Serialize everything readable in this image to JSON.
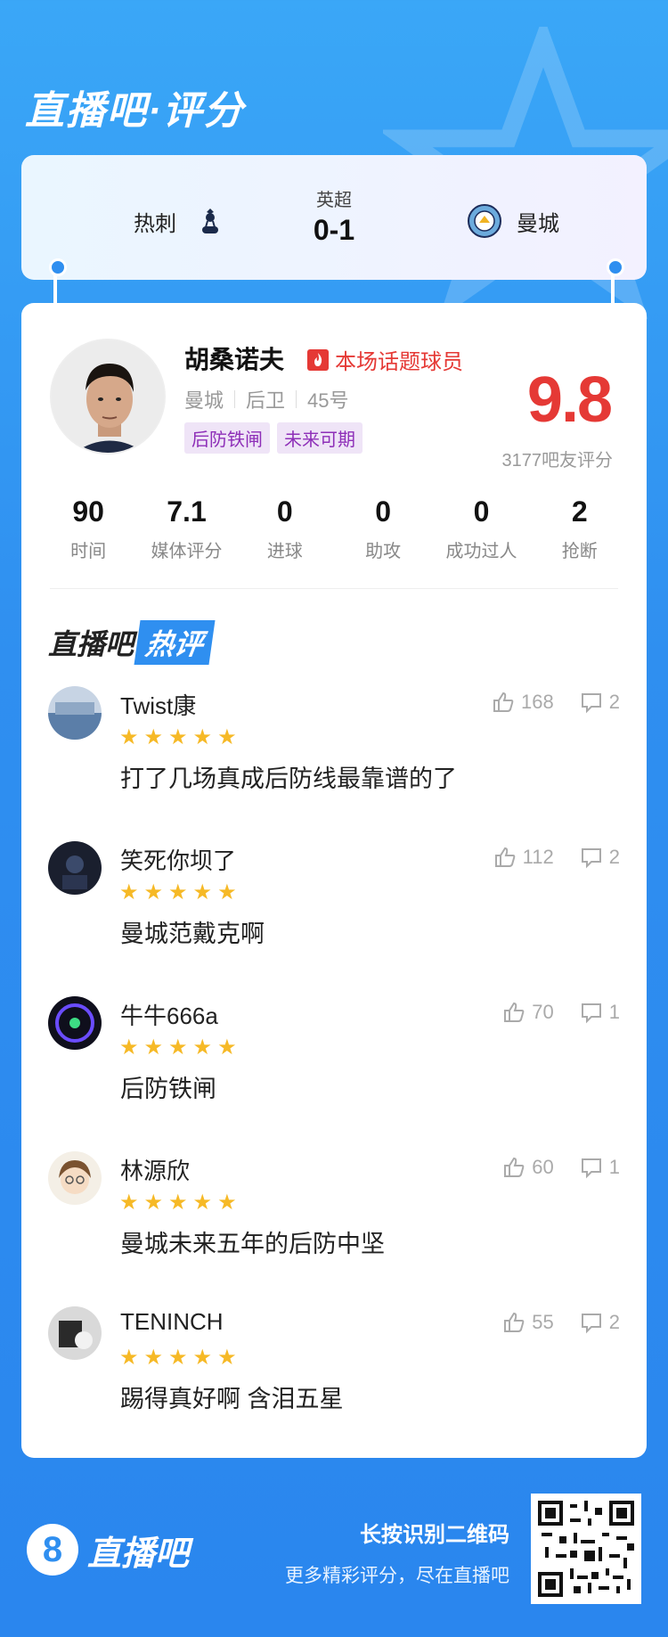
{
  "header": {
    "title": "直播吧·评分"
  },
  "match": {
    "league": "英超",
    "score": "0-1",
    "home_team": "热刺",
    "away_team": "曼城",
    "home_crest": "tottenham-crest-icon",
    "away_crest": "man-city-crest-icon"
  },
  "player": {
    "name": "胡桑诺夫",
    "badge": "本场话题球员",
    "team": "曼城",
    "position": "后卫",
    "number": "45号",
    "tags": [
      "后防铁闸",
      "未来可期"
    ],
    "rating": "9.8",
    "votes": "3177吧友评分"
  },
  "stats": [
    {
      "value": "90",
      "label": "时间"
    },
    {
      "value": "7.1",
      "label": "媒体评分"
    },
    {
      "value": "0",
      "label": "进球"
    },
    {
      "value": "0",
      "label": "助攻"
    },
    {
      "value": "0",
      "label": "成功过人"
    },
    {
      "value": "2",
      "label": "抢断"
    }
  ],
  "hot_section": {
    "title_a": "直播吧",
    "title_b": "热评"
  },
  "comments": [
    {
      "user": "Twist康",
      "likes": "168",
      "replies": "2",
      "stars": 5,
      "text": "打了几场真成后防线最靠谱的了"
    },
    {
      "user": "笑死你坝了",
      "likes": "112",
      "replies": "2",
      "stars": 5,
      "text": "曼城范戴克啊"
    },
    {
      "user": "牛牛666a",
      "likes": "70",
      "replies": "1",
      "stars": 5,
      "text": "后防铁闸"
    },
    {
      "user": "林源欣",
      "likes": "60",
      "replies": "1",
      "stars": 5,
      "text": "曼城未来五年的后防中坚"
    },
    {
      "user": "TENINCH",
      "likes": "55",
      "replies": "2",
      "stars": 5,
      "text": "踢得真好啊 含泪五星"
    }
  ],
  "footer": {
    "logo_mark": "8",
    "logo_text": "直播吧",
    "line1": "长按识别二维码",
    "line2": "更多精彩评分，尽在直播吧"
  },
  "colors": {
    "accent": "#2f8ff0",
    "rating": "#e53935",
    "star": "#f6b926",
    "tag_bg": "#efe4f7",
    "tag_fg": "#8e2fb8"
  }
}
